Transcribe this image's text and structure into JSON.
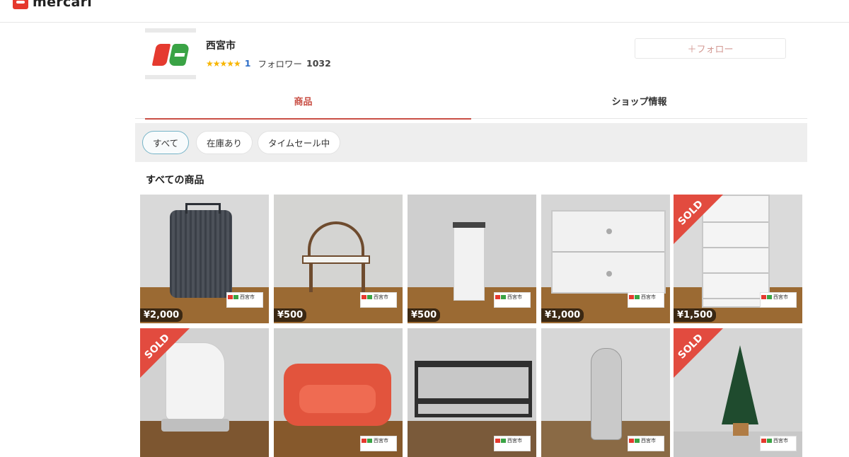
{
  "header": {
    "brand": "mercari"
  },
  "shop": {
    "name": "西宮市",
    "stars": "★★★★★",
    "rating_count": "1",
    "follower_label": "フォロワー",
    "follower_count": "1032",
    "follow_button": "＋フォロー"
  },
  "tabs": [
    {
      "label": "商品",
      "active": true
    },
    {
      "label": "ショップ情報",
      "active": false
    }
  ],
  "filters": [
    {
      "label": "すべて",
      "active": true
    },
    {
      "label": "在庫あり",
      "active": false
    },
    {
      "label": "タイムセール中",
      "active": false
    }
  ],
  "section_title": "すべての商品",
  "label_text": "西宮市",
  "products": [
    {
      "item": "suitcase",
      "price": "¥2,000",
      "sold": false
    },
    {
      "item": "baby-chair",
      "price": "¥500",
      "sold": false
    },
    {
      "item": "trash-can",
      "price": "¥500",
      "sold": false
    },
    {
      "item": "drawer-cabinet",
      "price": "¥1,000",
      "sold": false
    },
    {
      "item": "drawer-tower",
      "price": "¥1,500",
      "sold": true
    },
    {
      "item": "electric-kettle",
      "price": "",
      "sold": true
    },
    {
      "item": "sofa-bed",
      "price": "",
      "sold": false
    },
    {
      "item": "metal-cart",
      "price": "",
      "sold": false
    },
    {
      "item": "ironing-board",
      "price": "",
      "sold": false
    },
    {
      "item": "christmas-tree",
      "price": "",
      "sold": true
    }
  ],
  "sold_label": "SOLD"
}
